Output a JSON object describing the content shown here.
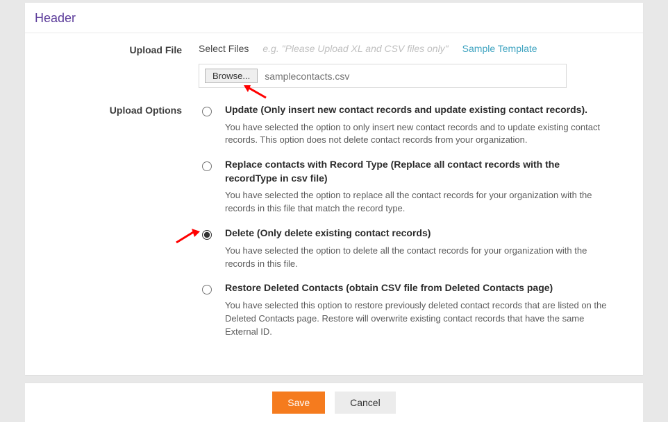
{
  "header": {
    "title": "Header"
  },
  "upload_file": {
    "label": "Upload File",
    "select_files": "Select Files",
    "placeholder_hint": "e.g. \"Please Upload XL and CSV files only\"",
    "sample_link": "Sample Template",
    "browse_label": "Browse...",
    "filename": "samplecontacts.csv"
  },
  "upload_options": {
    "label": "Upload Options",
    "selected": "delete",
    "items": [
      {
        "id": "update",
        "title": "Update (Only insert new contact records and update existing contact records).",
        "desc": "You have selected the option to only insert new contact records and to update existing contact records. This option does not delete contact records from your organization."
      },
      {
        "id": "replace",
        "title": "Replace contacts with Record Type (Replace all contact records with the recordType in csv file)",
        "desc": "You have selected the option to replace all the contact records for your organization with the records in this file that match the record type."
      },
      {
        "id": "delete",
        "title": "Delete (Only delete existing contact records)",
        "desc": "You have selected the option to delete all the contact records for your organization with the records in this file."
      },
      {
        "id": "restore",
        "title": "Restore Deleted Contacts (obtain CSV file from Deleted Contacts page)",
        "desc": "You have selected this option to restore previously deleted contact records that are listed on the Deleted Contacts page. Restore will overwrite existing contact records that have the same External ID."
      }
    ]
  },
  "footer": {
    "save": "Save",
    "cancel": "Cancel"
  }
}
